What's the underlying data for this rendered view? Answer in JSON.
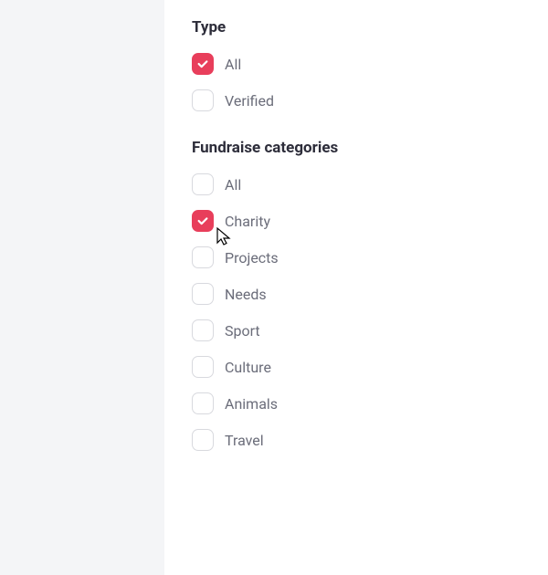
{
  "type": {
    "title": "Type",
    "options": [
      {
        "label": "All",
        "checked": true
      },
      {
        "label": "Verified",
        "checked": false
      }
    ]
  },
  "categories": {
    "title": "Fundraise categories",
    "options": [
      {
        "label": "All",
        "checked": false
      },
      {
        "label": "Charity",
        "checked": true
      },
      {
        "label": "Projects",
        "checked": false
      },
      {
        "label": "Needs",
        "checked": false
      },
      {
        "label": "Sport",
        "checked": false
      },
      {
        "label": "Culture",
        "checked": false
      },
      {
        "label": "Animals",
        "checked": false
      },
      {
        "label": "Travel",
        "checked": false
      }
    ]
  }
}
